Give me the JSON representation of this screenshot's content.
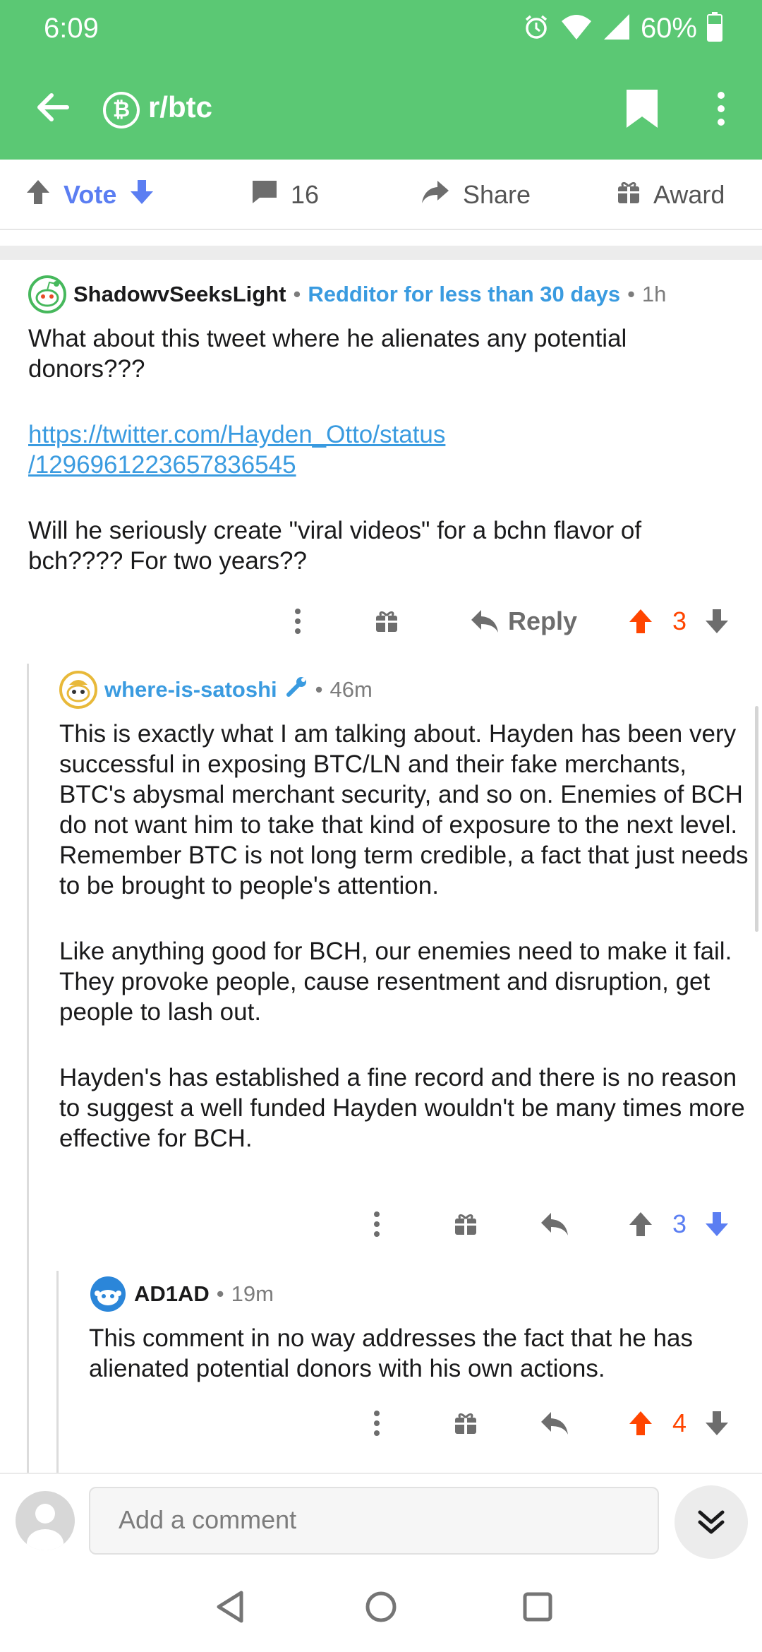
{
  "status_bar": {
    "time": "6:09",
    "battery": "60%"
  },
  "header": {
    "subreddit": "r/btc",
    "subreddit_icon": "bitcoin-icon"
  },
  "actions": {
    "vote": "Vote",
    "comments_count": "16",
    "share": "Share",
    "award": "Award"
  },
  "comments": [
    {
      "username": "ShadowvSeeksLight",
      "flair": "Redditor for less than 30 days",
      "age": "1h",
      "paragraphs": [
        "What about this tweet where he alienates any potential donors???",
        "Will he seriously create \"viral videos\" for a bchn flavor of bch???? For two years??"
      ],
      "link": "https://twitter.com/Hayden_Otto/status /1296961223657836545",
      "reply_label": "Reply",
      "score": "3"
    },
    {
      "username": "where-is-satoshi",
      "age": "46m",
      "paragraphs": [
        "This is exactly what I am talking about. Hayden has been very successful in exposing BTC/LN and their fake merchants, BTC's abysmal merchant security, and so on. Enemies of BCH do not want him to take that kind of exposure to the next level. Remember BTC is not long term credible, a fact that just needs to be brought to people's attention.",
        "Like anything good for BCH, our enemies need to make it fail. They provoke people, cause resentment and disruption, get people to lash out.",
        "Hayden's has established a fine record and there is no reason to suggest a well funded Hayden wouldn't be many times more effective for BCH."
      ],
      "score": "3"
    },
    {
      "username": "AD1AD",
      "age": "19m",
      "paragraphs": [
        "This comment in no way addresses the fact that he has alienated potential donors with his own actions."
      ],
      "score": "4"
    }
  ],
  "composer": {
    "placeholder": "Add a comment"
  },
  "colors": {
    "header_green": "#5bc874",
    "upvote_orange": "#ff4500",
    "downvote_blue": "#5b7ef2",
    "link_blue": "#3a9be0"
  }
}
